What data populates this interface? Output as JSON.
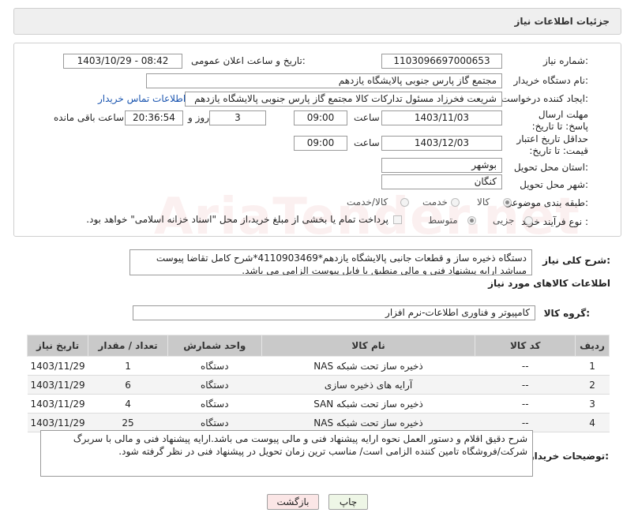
{
  "header": {
    "title": "جزئیات اطلاعات نیاز"
  },
  "form": {
    "need_number_label": "شماره نیاز:",
    "need_number": "1103096697000653",
    "announce_label": "تاریخ و ساعت اعلان عمومی:",
    "announce_value": "1403/10/29 - 08:42",
    "buyer_org_label": "نام دستگاه خریدار:",
    "buyer_org": "مجتمع گاز پارس جنوبی  پالایشگاه یازدهم",
    "creator_label": "ایجاد کننده درخواست:",
    "creator": "شریعت فخرزاد مسئول تدارکات کالا مجتمع گاز پارس جنوبی  پالایشگاه یازدهم",
    "buyer_contact_link": "اطلاعات تماس خریدار",
    "send_deadline_label": "مهلت ارسال پاسخ: تا تاریخ:",
    "send_deadline_date": "1403/11/03",
    "time_label": "ساعت",
    "send_deadline_time": "09:00",
    "days_value": "3",
    "day_and_label": "روز و",
    "remaining_time": "20:36:54",
    "remaining_label": "ساعت باقی مانده",
    "price_validity_label": "حداقل تاریخ اعتبار قیمت: تا تاریخ:",
    "price_validity_date": "1403/12/03",
    "price_validity_time": "09:00",
    "province_label": "استان محل تحویل:",
    "province": "بوشهر",
    "city_label": "شهر محل تحویل:",
    "city": "کنگان",
    "category_label": "طبقه بندی موضوعی:",
    "category_options": [
      "کالا",
      "خدمت",
      "کالا/خدمت"
    ],
    "process_label": "نوع فرآیند خرید :",
    "process_options": [
      "جزیی",
      "متوسط"
    ],
    "payment_note": "پرداخت تمام یا بخشی از مبلغ خرید،از محل \"اسناد خزانه اسلامی\" خواهد بود."
  },
  "description": {
    "label": "شرح کلی نیاز:",
    "text": "دستگاه ذخیره ساز و قطعات جانبی پالایشگاه یازدهم*4110903469*شرح کامل تقاضا پیوست میباشد ارایه پیشنهاد فنی و مالی منطبق با فایل پیوست الزامی می باشد."
  },
  "goods": {
    "section_title": "اطلاعات کالاهای مورد نیاز",
    "group_label": "گروه کالا:",
    "group_value": "کامپیوتر و فناوری اطلاعات-نرم افزار",
    "columns": [
      "ردیف",
      "کد کالا",
      "نام کالا",
      "واحد شمارش",
      "تعداد / مقدار",
      "تاریخ نیاز"
    ],
    "rows": [
      {
        "row": "1",
        "code": "--",
        "name": "ذخیره ساز تحت شبکه NAS",
        "unit": "دستگاه",
        "qty": "1",
        "date": "1403/11/29"
      },
      {
        "row": "2",
        "code": "--",
        "name": "آرایه های ذخیره سازی",
        "unit": "دستگاه",
        "qty": "6",
        "date": "1403/11/29"
      },
      {
        "row": "3",
        "code": "--",
        "name": "ذخیره ساز تحت شبکه SAN",
        "unit": "دستگاه",
        "qty": "4",
        "date": "1403/11/29"
      },
      {
        "row": "4",
        "code": "--",
        "name": "ذخیره ساز تحت شبکه NAS",
        "unit": "دستگاه",
        "qty": "25",
        "date": "1403/11/29"
      }
    ]
  },
  "buyer_notes": {
    "label": "توضیحات خریدار:",
    "text": "شرح دقیق اقلام و دستور العمل نحوه ارایه پیشنهاد فنی و مالی پیوست می باشد.ارایه پیشنهاد فنی و مالی با سربرگ شرکت/فروشگاه تامین کننده الزامی است/ مناسب ترین زمان تحویل در پیشنهاد فنی در نظر گرفته شود."
  },
  "buttons": {
    "print": "چاپ",
    "back": "بازگشت"
  },
  "watermark": "AriaTender.net"
}
